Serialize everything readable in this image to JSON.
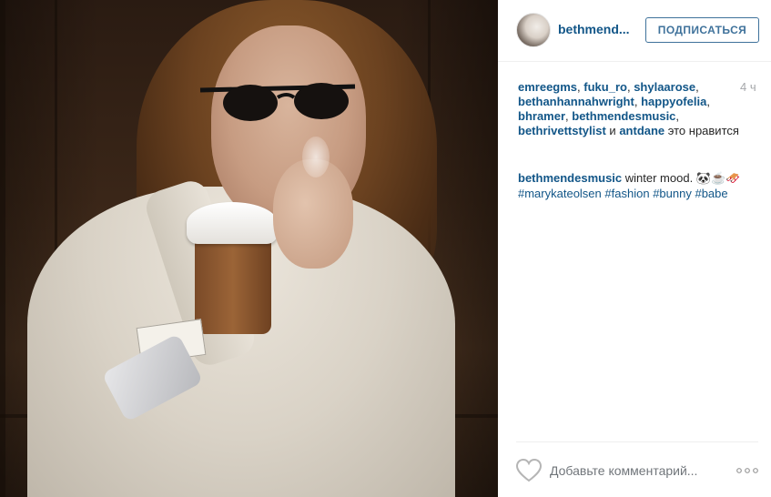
{
  "post": {
    "photo_alt": "post-photo",
    "username": "bethmend...",
    "follow_label": "ПОДПИСАТЬСЯ",
    "time_ago": "4 ч",
    "likes": {
      "names": [
        "emreegms",
        "fuku_ro",
        "shylaarose",
        "bethanhannahwright",
        "happyofelia",
        "bhramer",
        "bethmendesmusic",
        "bethrivettstylist",
        "antdane"
      ],
      "separator": ", ",
      "and_word": " и ",
      "suffix": " это нравится"
    },
    "caption": {
      "author": "bethmendesmusic",
      "text": " winter mood. 🐼☕🛷",
      "hashtags": [
        "#marykateolsen",
        "#fashion",
        "#bunny",
        "#babe"
      ]
    },
    "comment_placeholder": "Добавьте комментарий...",
    "icons": {
      "like": "heart-icon",
      "more": "more-options-icon"
    },
    "colors": {
      "link": "#125688",
      "follow": "#3f729b",
      "muted": "#a5a7aa"
    }
  }
}
